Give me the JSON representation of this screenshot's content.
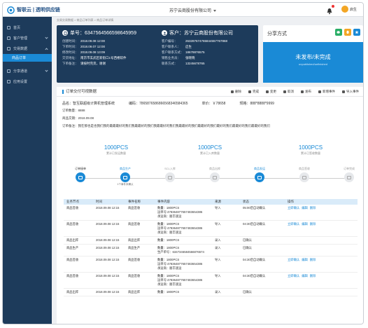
{
  "header": {
    "logo_text": "智联云 | 透明供应链",
    "company": "苏宁云商股份有限公司",
    "user": "启生"
  },
  "sidebar": {
    "items": [
      {
        "label": "首页",
        "icon": "home-icon"
      },
      {
        "label": "客户管理",
        "icon": "users-icon"
      },
      {
        "label": "交易数据",
        "icon": "data-icon",
        "sub": "商品订单"
      },
      {
        "label": "分享通道",
        "icon": "share-icon"
      },
      {
        "label": "应用设置",
        "icon": "settings-icon"
      }
    ]
  },
  "breadcrumb": "交易交易数据 > 商品订单列表 > 商品订单详情",
  "order": {
    "number_label": "单号：63475645665986459​59",
    "rows": [
      {
        "k": "创建时间：",
        "v": "2018.09.08  12:00"
      },
      {
        "k": "下单时间：",
        "v": "2018.09.07  12:00"
      },
      {
        "k": "修改时间：",
        "v": "2018.09.08  13:09"
      },
      {
        "k": "交货地址：",
        "v": "南京市玄武区新街口1号西楼软件"
      },
      {
        "k": "下单备注：",
        "v": "请按时完货，谢谢"
      }
    ]
  },
  "customer": {
    "title": "客户：苏宁云商股份有限公司",
    "rows": [
      {
        "k": "客户编号：",
        "v": "263287674765844557767868"
      },
      {
        "k": "客户联系人：",
        "v": "启生"
      },
      {
        "k": "客户联系方式：",
        "v": "18678876575"
      },
      {
        "k": "销售业务员：",
        "v": "张晓晓"
      },
      {
        "k": "联系方式：",
        "v": "13245678765"
      }
    ]
  },
  "share": {
    "title": "分享方式",
    "status": "未发布/未完成",
    "status_en": "unpublished/unfinished"
  },
  "detail": {
    "title": "订单交付可视数据",
    "actions": [
      "删除",
      "完成",
      "变更",
      "取消",
      "发布",
      "新增事件",
      "导入事件"
    ],
    "product": {
      "name": "品名：智互联超级计算机管理系统",
      "code": "编码：786587658686656834658436​5",
      "price": "单价：￥78658",
      "spec": "规格：888*8888*9999"
    },
    "order_qty": "订单数量：8888",
    "produce_date": "商品交期：2018.09.08",
    "remark": "订单备注：我在那也是也我们我的最最最好的我们我最最好的我们我最最好的我们我最最好的我们最最好的我们最好的我们最最好的我们最最好的我们",
    "stats": [
      {
        "n": "1000PCS",
        "l": "累计已发运数量"
      },
      {
        "n": "1000PCS",
        "l": "累计已入库数量"
      },
      {
        "n": "1000PCS",
        "l": "累计已签收数量"
      }
    ],
    "steps": [
      {
        "label": "订单接单",
        "state": "done",
        "sub": ""
      },
      {
        "label": "商品生产",
        "state": "active",
        "sub": "1个事件未确认"
      },
      {
        "label": "SCL入库",
        "state": "off",
        "sub": ""
      },
      {
        "label": "商品出库",
        "state": "off",
        "sub": ""
      },
      {
        "label": "商品发运",
        "state": "active",
        "sub": ""
      },
      {
        "label": "商品签收",
        "state": "off",
        "sub": ""
      },
      {
        "label": "订单完成",
        "state": "off",
        "sub": ""
      }
    ],
    "table_headers": [
      "业务节点",
      "时间",
      "事件名称",
      "事件内容",
      "来源",
      "状态",
      "操作"
    ],
    "rows": [
      {
        "node": "商品签收",
        "time": "2018.09.08  12:15",
        "event": "商品签收",
        "content": [
          "数量：1800PCS",
          "运单号:4783648776574836543​86",
          "承运商：顺丰速运"
        ],
        "src": "导入",
        "status": "05:00后自动确认",
        "ops": [
          "立即确认",
          "编辑",
          "删除"
        ]
      },
      {
        "node": "商品签收",
        "time": "2018.09.08  12:15",
        "event": "商品签收",
        "content": [
          "数量：1800PCS",
          "运单号:4783648776574836543​86",
          "承运商：顺丰速运"
        ],
        "src": "导入",
        "status": "04:30后自动确认",
        "ops": [
          "立即确认",
          "编辑",
          "删除"
        ]
      },
      {
        "node": "商品出库",
        "time": "2018.09.08  12:15",
        "event": "商品出库",
        "content": [
          "数量：1800PCS"
        ],
        "src": "录入",
        "status": "已确认",
        "ops": []
      },
      {
        "node": "商品生产",
        "time": "2018.09.08  12:15",
        "event": "商品生产",
        "content": [
          "数量：1800PCS",
          "生产单号：634734658456687657​4"
        ],
        "src": "录入",
        "status": "已确认",
        "ops": []
      },
      {
        "node": "商品签收",
        "time": "2018.09.08  12:15",
        "event": "商品签收",
        "content": [
          "数量：1800PCS",
          "运单号:4783648776574836543​86",
          "承运商：顺丰速运"
        ],
        "src": "导入",
        "status": "04:30后自动确认",
        "ops": [
          "立即确认",
          "编辑",
          "删除"
        ]
      },
      {
        "node": "商品签收",
        "time": "2018.09.08  12:15",
        "event": "商品签收",
        "content": [
          "数量：1800PCS",
          "运单号:4783648776574836543​86",
          "承运商：顺丰速运"
        ],
        "src": "导入",
        "status": "04:30后自动确认",
        "ops": [
          "立即确认",
          "编辑",
          "删除"
        ]
      },
      {
        "node": "商品出库",
        "time": "2018.09.08  12:15",
        "event": "商品出库",
        "content": [
          "数量：1800PCS"
        ],
        "src": "录入",
        "status": "已确认",
        "ops": []
      }
    ]
  },
  "colors": {
    "primary": "#1a8ad6",
    "navy": "#1d3b5b",
    "wechat": "#2aae67",
    "qq": "#f3a625",
    "qzone": "#1a8ad6"
  }
}
